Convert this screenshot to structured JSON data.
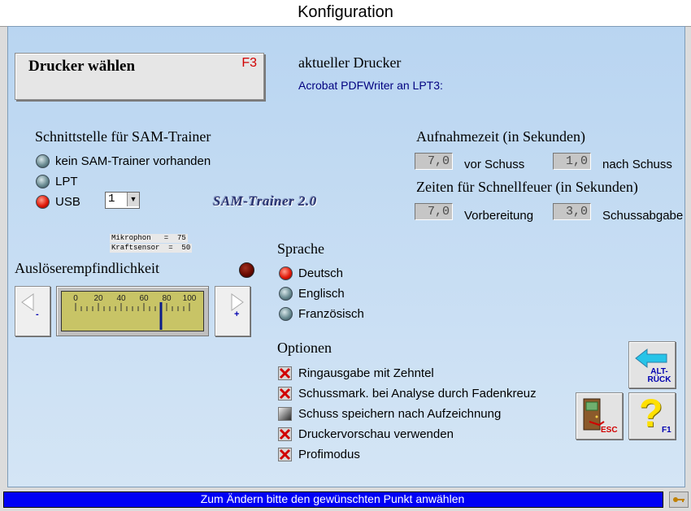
{
  "window": {
    "title": "Konfiguration"
  },
  "printer": {
    "button_label": "Drucker wählen",
    "button_key": "F3",
    "current_label": "aktueller Drucker",
    "current_value": "Acrobat PDFWriter an LPT3:"
  },
  "interface": {
    "heading": "Schnittstelle für SAM-Trainer",
    "options": [
      {
        "label": "kein SAM-Trainer vorhanden",
        "selected": false
      },
      {
        "label": "LPT",
        "selected": false
      },
      {
        "label": "USB",
        "selected": true
      }
    ],
    "usb_port_value": "1",
    "logo_text": "SAM-Trainer 2.0"
  },
  "recording_time": {
    "heading": "Aufnahmezeit (in Sekunden)",
    "before_value": "7,0",
    "before_label": "vor Schuss",
    "after_value": "1,0",
    "after_label": "nach Schuss"
  },
  "rapid_fire": {
    "heading": "Zeiten für Schnellfeuer (in Sekunden)",
    "prep_value": "7,0",
    "prep_label": "Vorbereitung",
    "shot_value": "3,0",
    "shot_label": "Schussabgabe"
  },
  "sensors": {
    "microphone": "Mikrophon   =  75",
    "force": "Kraftsensor  =  50"
  },
  "sensitivity": {
    "heading": "Auslöserempfindlichkeit",
    "minus_label": "-",
    "plus_label": "+",
    "scale_labels": [
      "0",
      "20",
      "40",
      "60",
      "80",
      "100"
    ],
    "value": 75
  },
  "language": {
    "heading": "Sprache",
    "options": [
      {
        "label": "Deutsch",
        "selected": true
      },
      {
        "label": "Englisch",
        "selected": false
      },
      {
        "label": "Französisch",
        "selected": false
      }
    ]
  },
  "options": {
    "heading": "Optionen",
    "items": [
      {
        "label": "Ringausgabe mit Zehntel",
        "checked": true
      },
      {
        "label": "Schussmark. bei Analyse durch Fadenkreuz",
        "checked": true
      },
      {
        "label": "Schuss speichern nach Aufzeichnung",
        "checked": false
      },
      {
        "label": "Druckervorschau verwenden",
        "checked": true
      },
      {
        "label": "Profimodus",
        "checked": true
      }
    ]
  },
  "buttons": {
    "back_line1": "ALT-",
    "back_line2": "RÜCK",
    "esc_label": "ESC",
    "help_label": "F1",
    "help_glyph": "?"
  },
  "statusbar": {
    "text": "Zum Ändern bitte den gewünschten Punkt anwählen"
  },
  "colors": {
    "accent_red": "#d10000",
    "status_blue": "#0000f5",
    "text_blue": "#000080"
  }
}
